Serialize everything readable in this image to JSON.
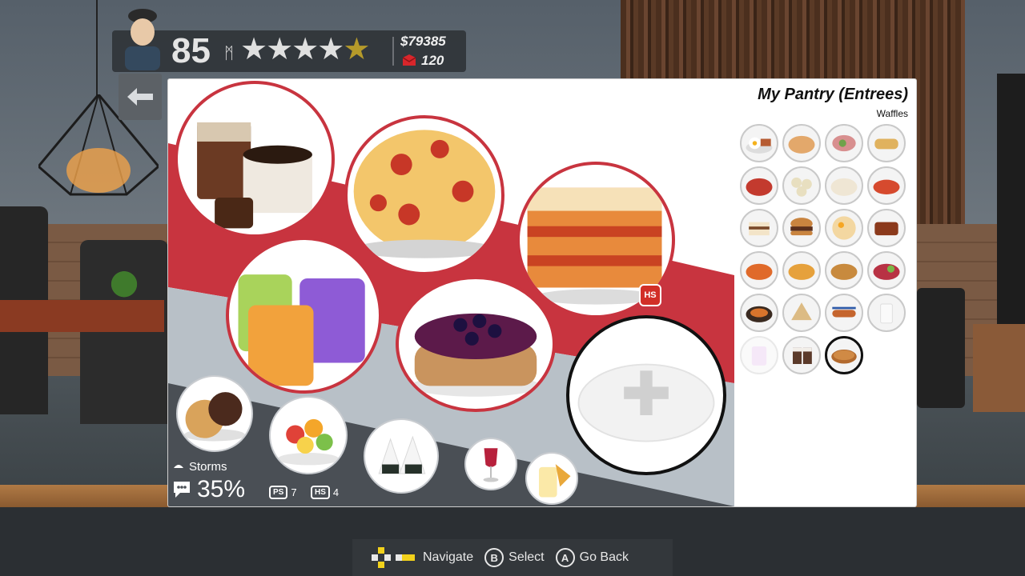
{
  "hud": {
    "level": "85",
    "level_icon": "ᛗ",
    "stars_filled": 3.5,
    "stars_total": 5,
    "money": "$79385",
    "gems": "120"
  },
  "pantry": {
    "title": "My Pantry (Entrees)",
    "selected_item": "Waffles"
  },
  "stats": {
    "weather": "Storms",
    "percent": "35%",
    "ps_label": "PS",
    "ps_count": "7",
    "hs_label": "HS",
    "hs_count": "4",
    "hs_badge": "HS"
  },
  "controls": {
    "navigate": "Navigate",
    "select_key": "B",
    "select": "Select",
    "back_key": "A",
    "back": "Go Back"
  },
  "menu_slots": [
    {
      "name": "coffee-drinks",
      "border": "red"
    },
    {
      "name": "pepperoni-pizza",
      "border": "red"
    },
    {
      "name": "lasagna",
      "border": "red"
    },
    {
      "name": "slushies",
      "border": "red"
    },
    {
      "name": "blueberry-pancakes",
      "border": "red"
    },
    {
      "name": "empty-slot",
      "border": "black"
    },
    {
      "name": "cookies",
      "border": "gray"
    },
    {
      "name": "fruit-salad",
      "border": "gray"
    },
    {
      "name": "rice-balls",
      "border": "gray"
    },
    {
      "name": "wine",
      "border": "gray"
    },
    {
      "name": "pina-colada",
      "border": "gray"
    }
  ],
  "pantry_items": [
    "fried-eggs",
    "pasta",
    "stuffed-roast",
    "burrito",
    "shrimp-dish",
    "dumplings",
    "salad",
    "lobster",
    "tiramisu",
    "burger",
    "ramen",
    "chicken-wings",
    "crab-legs",
    "fried-shrimp",
    "noodles",
    "fried-rice",
    "fajitas",
    "wrap",
    "hot-dog",
    "milk",
    "faded-drink",
    "hot-chocolate",
    "waffles"
  ],
  "colors": {
    "accent_red": "#c8343f",
    "band_gray": "#b8c0c7",
    "hud_bg": "#303438"
  }
}
